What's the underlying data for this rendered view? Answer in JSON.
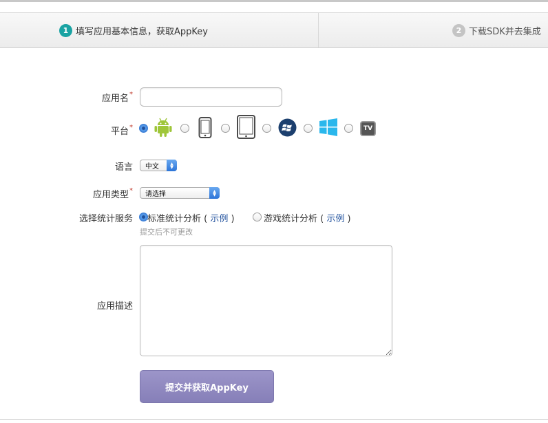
{
  "steps": [
    {
      "num": "1",
      "label": "填写应用基本信息，获取AppKey"
    },
    {
      "num": "2",
      "label": "下载SDK并去集成"
    }
  ],
  "form": {
    "app_name": {
      "label": "应用名",
      "required_mark": "*",
      "value": ""
    },
    "platform": {
      "label": "平台",
      "required_mark": "*",
      "options": [
        {
          "icon": "android-icon",
          "selected": true
        },
        {
          "icon": "iphone-icon",
          "selected": false
        },
        {
          "icon": "ipad-icon",
          "selected": false
        },
        {
          "icon": "windows-phone-icon",
          "selected": false
        },
        {
          "icon": "windows-icon",
          "selected": false
        },
        {
          "icon": "tv-icon",
          "selected": false,
          "text": "TV"
        }
      ]
    },
    "language": {
      "label": "语言",
      "value": "中文"
    },
    "app_type": {
      "label": "应用类型",
      "required_mark": "*",
      "value": "请选择"
    },
    "service": {
      "label": "选择统计服务",
      "options": [
        {
          "label": "标准统计分析",
          "open": " ( ",
          "example": "示例",
          "close": " )",
          "selected": true
        },
        {
          "label": "游戏统计分析",
          "open": " ( ",
          "example": "示例",
          "close": " )",
          "selected": false
        }
      ],
      "hint": "提交后不可更改"
    },
    "description": {
      "label": "应用描述",
      "value": ""
    },
    "submit_label": "提交并获取AppKey"
  },
  "colors": {
    "step_active": "#1aa3a3",
    "step_inactive": "#c4c4c4",
    "submit_bg": "#8f88c0",
    "link": "#1e4f9c",
    "required": "#c0392b"
  }
}
